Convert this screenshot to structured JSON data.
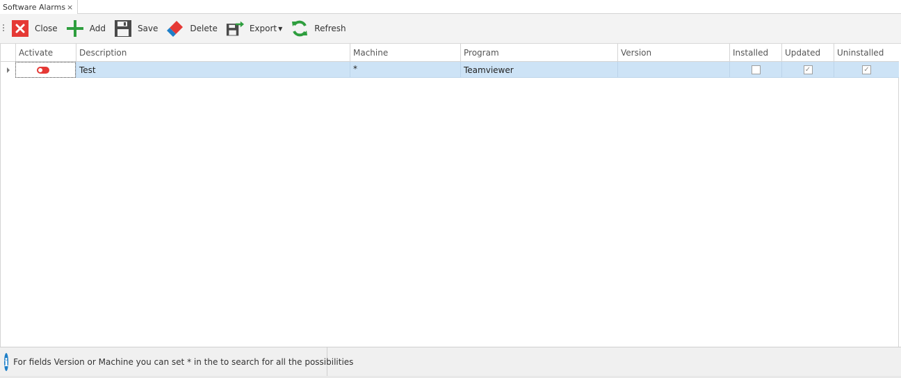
{
  "tab": {
    "title": "Software Alarms",
    "close_glyph": "×"
  },
  "toolbar": {
    "buttons": [
      {
        "id": "close",
        "label": "Close",
        "icon": "close-icon",
        "color": "#e53935"
      },
      {
        "id": "add",
        "label": "Add",
        "icon": "plus-icon",
        "color": "#2e9e3e"
      },
      {
        "id": "save",
        "label": "Save",
        "icon": "floppy-disk-icon",
        "color": "#4a4a4a"
      },
      {
        "id": "delete",
        "label": "Delete",
        "icon": "eraser-icon",
        "color": "#e53935"
      },
      {
        "id": "export",
        "label": "Export",
        "icon": "export-icon",
        "color": "#4a4a4a"
      },
      {
        "id": "refresh",
        "label": "Refresh",
        "icon": "refresh-icon",
        "color": "#2e9e3e"
      }
    ]
  },
  "grid": {
    "columns": [
      "Activate",
      "Description",
      "Machine",
      "Program",
      "Version",
      "Installed",
      "Updated",
      "Uninstalled"
    ],
    "rows": [
      {
        "activate": false,
        "description": "Test",
        "machine": "*",
        "program": "Teamviewer",
        "version": "",
        "installed": false,
        "updated": true,
        "uninstalled": true
      }
    ],
    "selected_row_color": "#cde3f6"
  },
  "status": {
    "message": "For fields Version or Machine you can set * in the to search for all the possibilities",
    "icon": "info-icon",
    "info_glyph": "i"
  },
  "glyphs": {
    "check": "✓"
  }
}
